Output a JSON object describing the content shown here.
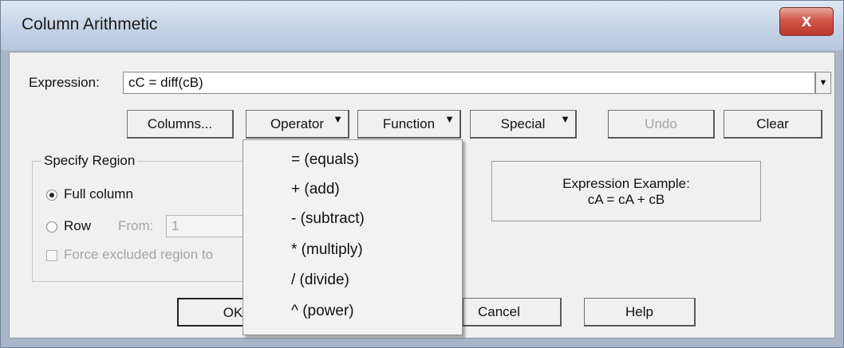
{
  "window": {
    "title": "Column Arithmetic",
    "close_glyph": "x"
  },
  "expression": {
    "label": "Expression:",
    "value": "cC = diff(cB)"
  },
  "toolbar": {
    "columns": "Columns...",
    "operator": "Operator",
    "function": "Function",
    "special": "Special",
    "undo": "Undo",
    "clear": "Clear"
  },
  "region": {
    "legend": "Specify Region",
    "full_column": "Full column",
    "row": "Row",
    "from_label": "From:",
    "from_value": "1",
    "force_excluded": "Force excluded region to"
  },
  "example": {
    "title": "Expression Example:",
    "value": "cA = cA + cB"
  },
  "footer": {
    "ok": "OK",
    "cancel": "Cancel",
    "help": "Help"
  },
  "operator_menu": {
    "items": [
      "= (equals)",
      "+ (add)",
      "- (subtract)",
      "* (multiply)",
      "/ (divide)",
      "^ (power)"
    ]
  },
  "colors": {
    "dialog_bg": "#f0f0f0",
    "close_red": "#d0584a",
    "disabled_text": "#a5a5a5"
  }
}
